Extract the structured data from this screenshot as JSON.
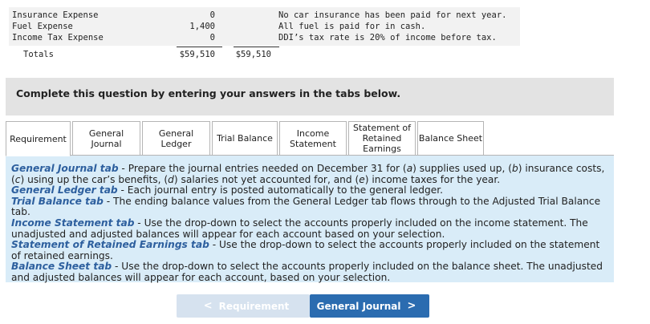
{
  "trial_table": {
    "rows": [
      {
        "label": "Insurance Expense",
        "debit": "0"
      },
      {
        "label": "Fuel Expense",
        "debit": "1,400"
      },
      {
        "label": "Income Tax Expense",
        "debit": "0"
      }
    ],
    "notes": [
      "No car insurance has been paid for next year.",
      "All fuel is paid for in cash.",
      "DDI’s tax rate is 20% of income before tax."
    ],
    "totals": {
      "label": "Totals",
      "debit": "$59,510",
      "credit": "$59,510"
    }
  },
  "banner": {
    "text": "Complete this question by entering your answers in the tabs below."
  },
  "tabs": [
    {
      "label": "Requirement",
      "active": true
    },
    {
      "label": "General Journal",
      "active": false
    },
    {
      "label": "General Ledger",
      "active": false
    },
    {
      "label": "Trial Balance",
      "active": false
    },
    {
      "label": "Income Statement",
      "active": false
    },
    {
      "label": "Statement of Retained Earnings",
      "active": false
    },
    {
      "label": "Balance Sheet",
      "active": false
    }
  ],
  "instructions": {
    "gj_title": "General Journal tab",
    "gj_text_1": " - Prepare the journal entries needed on December 31 for (",
    "gj_a": "a",
    "gj_text_2": ") supplies used up, (",
    "gj_b": "b",
    "gj_text_3": ") insurance costs, (",
    "gj_c": "c",
    "gj_text_4": ") using up the car’s benefits, (",
    "gj_d": "d",
    "gj_text_5": ") salaries not yet accounted for, and (",
    "gj_e": "e",
    "gj_text_6": ") income taxes for the year.",
    "gl_title": "General Ledger tab",
    "gl_text": " - Each journal entry is posted automatically to the general ledger.",
    "tb_title": "Trial Balance tab",
    "tb_text": " - The ending balance values from the General Ledger tab flows through to the Adjusted Trial Balance tab.",
    "is_title": "Income Statement tab",
    "is_text": " - Use the drop-down to select the accounts properly included on the income statement. The unadjusted and adjusted balances will appear for each account based on your selection.",
    "sre_title": "Statement of Retained Earnings tab",
    "sre_text": " - Use the drop-down to select the accounts properly included on the statement of retained earnings.",
    "bs_title": "Balance Sheet tab",
    "bs_text": " - Use the drop-down to select the accounts properly included on the balance sheet. The unadjusted and adjusted balances will appear for each account, based on your selection."
  },
  "nav": {
    "prev_label": "Requirement",
    "next_label": "General Journal",
    "prev_chevron": "<",
    "next_chevron": ">"
  }
}
